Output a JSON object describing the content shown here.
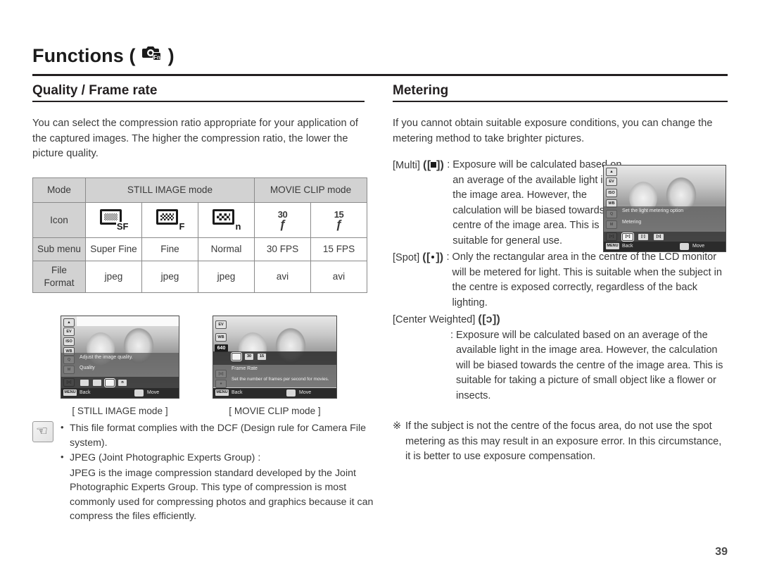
{
  "header": {
    "chapter_title_prefix": "Functions (",
    "chapter_title_suffix": ")",
    "camera_icon": "camera-fn-icon"
  },
  "left": {
    "section_title": "Quality / Frame rate",
    "intro": "You can select the compression ratio appropriate for your application of the captured images. The higher the compression ratio, the lower the picture quality.",
    "table": {
      "row_labels": [
        "Mode",
        "Icon",
        "Sub menu",
        "File\nFormat"
      ],
      "label_mode": "Mode",
      "label_icon": "Icon",
      "label_submenu": "Sub menu",
      "label_fileformat_line1": "File",
      "label_fileformat_line2": "Format",
      "group_still": "STILL IMAGE mode",
      "group_movie": "MOVIE CLIP mode",
      "icons": [
        "SF",
        "F",
        "n",
        "30",
        "15"
      ],
      "submenus": [
        "Super Fine",
        "Fine",
        "Normal",
        "30 FPS",
        "15 FPS"
      ],
      "formats": [
        "jpeg",
        "jpeg",
        "jpeg",
        "avi",
        "avi"
      ]
    },
    "screen_still": {
      "caption": "[ STILL IMAGE mode ]",
      "desc_line": "Adjust the image quality.",
      "menu_label": "Quality",
      "back_key": "MENU",
      "back_label": "Back",
      "move_label": "Move",
      "chips": [
        "",
        "",
        "",
        "n"
      ]
    },
    "screen_movie": {
      "caption": "[ MOVIE CLIP mode ]",
      "resolution": "640",
      "desc_line": "Frame Rate",
      "menu_label": "Set the number of frames per second for movies.",
      "back_key": "MENU",
      "back_label": "Back",
      "move_label": "Move",
      "chips": [
        "",
        "30",
        "15"
      ]
    },
    "note": {
      "items": [
        "This file format complies with the DCF (Design rule for Camera File system).",
        "JPEG (Joint Photographic Experts Group) :"
      ],
      "sub_text": "JPEG is the image compression standard developed by the Joint Photographic Experts Group. This type of compression is most commonly used for compressing photos and graphics because it can compress the files efficiently."
    }
  },
  "right": {
    "section_title": "Metering",
    "intro": "If you cannot obtain suitable exposure conditions, you can change the metering method to take brighter pictures.",
    "definitions": [
      {
        "term": "[Multi]",
        "icon": "metering-multi-icon",
        "colon": ":",
        "desc": "Exposure will be calculated based on an average of the available light in the image area. However, the calculation will be biased towards the centre of the image area. This is suitable for general use."
      },
      {
        "term": "[Spot]",
        "icon": "metering-spot-icon",
        "colon": ":",
        "desc": "Only the rectangular area in the centre of the LCD monitor will be metered for light. This is suitable when the subject in the centre is exposed correctly, regardless of the back lighting."
      },
      {
        "term": "[Center Weighted]",
        "icon": "metering-center-weighted-icon",
        "colon": ":",
        "desc": "Exposure will be calculated based on an average of the available light in the image area. However, the calculation will be biased towards the centre of the image area. This is suitable for taking a picture of small object like a flower or insects."
      }
    ],
    "footnote_mark": "※",
    "footnote": "If the subject is not the centre of the focus area, do not use the spot metering as this may result in an exposure error. In this circumstance, it is better to use exposure compensation.",
    "screen_metering": {
      "desc_line": "Set the light metering option",
      "menu_label": "Metering",
      "back_key": "MENU",
      "back_label": "Back",
      "move_label": "Move",
      "chips": [
        "[=]",
        "[·]",
        "[ɔ]"
      ]
    }
  },
  "page_number": "39",
  "colors": {
    "text": "#3a3a3a",
    "heading": "#231f20",
    "table_header_bg": "#d2d2d2",
    "table_border": "#8a8a8a"
  }
}
